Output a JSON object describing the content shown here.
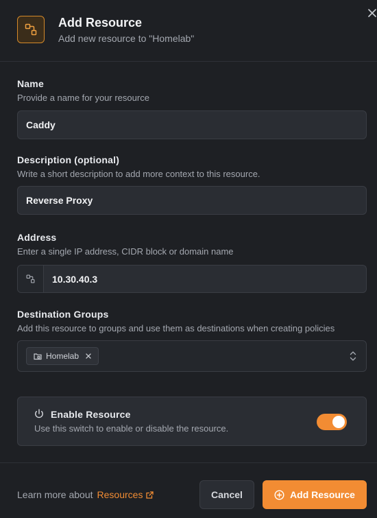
{
  "header": {
    "icon": "resource-icon",
    "title": "Add Resource",
    "subtitle": "Add new resource to \"Homelab\""
  },
  "fields": {
    "name": {
      "label": "Name",
      "help": "Provide a name for your resource",
      "value": "Caddy"
    },
    "description": {
      "label": "Description (optional)",
      "help": "Write a short description to add more context to this resource.",
      "value": "Reverse Proxy"
    },
    "address": {
      "label": "Address",
      "help": "Enter a single IP address, CIDR block or domain name",
      "value": "10.30.40.3"
    },
    "groups": {
      "label": "Destination Groups",
      "help": "Add this resource to groups and use them as destinations when creating policies",
      "selected": [
        "Homelab"
      ]
    }
  },
  "enable": {
    "title": "Enable Resource",
    "description": "Use this switch to enable or disable the resource.",
    "enabled": true
  },
  "footer": {
    "learn_prefix": "Learn more about",
    "learn_link": "Resources",
    "cancel_label": "Cancel",
    "add_label": "Add Resource"
  },
  "colors": {
    "accent": "#f28c33",
    "background": "#1e2024",
    "input_bg": "#2a2d33"
  }
}
